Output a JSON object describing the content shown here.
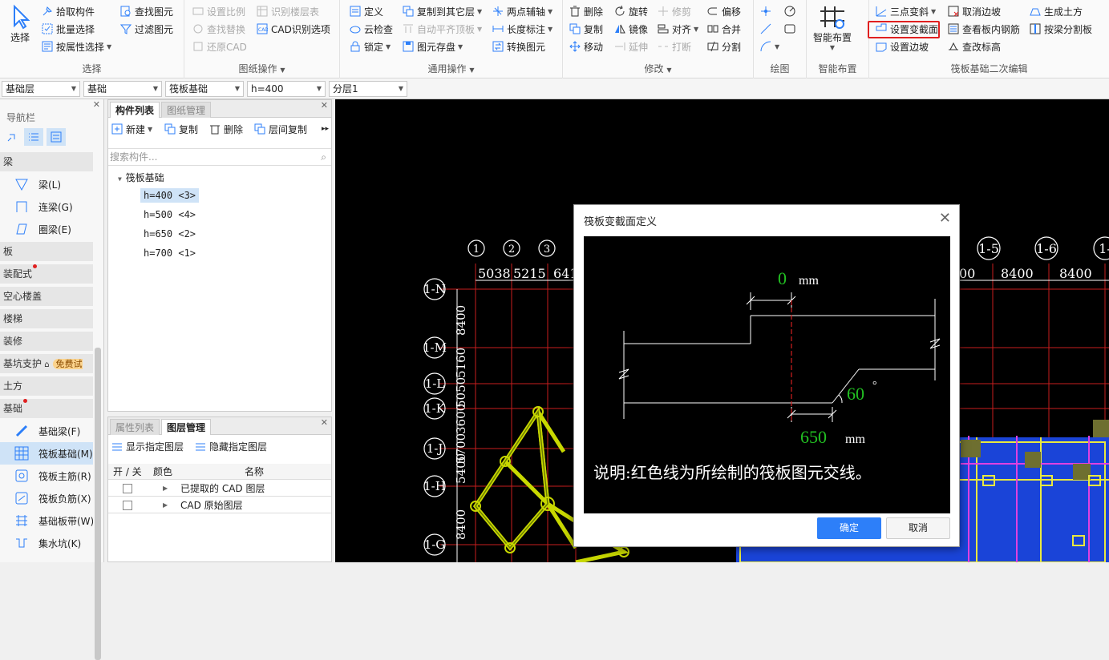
{
  "ribbon": {
    "select": {
      "big": "选择",
      "items": [
        "拾取构件",
        "批量选择",
        "按属性选择"
      ],
      "col2": [
        "查找图元",
        "过滤图元"
      ],
      "label": "选择"
    },
    "drawing_ops": {
      "col1": [
        "设置比例",
        "查找替换",
        "还原CAD"
      ],
      "col2": [
        "识别楼层表",
        "CAD识别选项"
      ],
      "label": "图纸操作"
    },
    "general_ops": {
      "col1": [
        "定义",
        "云检查",
        "锁定"
      ],
      "col2": [
        "复制到其它层",
        "自动平齐顶板",
        "图元存盘"
      ],
      "col3": [
        "两点辅轴",
        "长度标注",
        "转换图元"
      ],
      "label": "通用操作"
    },
    "modify": {
      "col1": [
        "删除",
        "复制",
        "移动"
      ],
      "col2": [
        "旋转",
        "镜像",
        "延伸"
      ],
      "col3": [
        "修剪",
        "对齐",
        "打断"
      ],
      "col4": [
        "偏移",
        "合并",
        "分割"
      ],
      "label": "修改"
    },
    "draw": {
      "label": "绘图"
    },
    "smart": {
      "big": "智能布置",
      "label": "智能布置"
    },
    "raft": {
      "col1": [
        "三点变斜",
        "设置变截面",
        "设置边坡"
      ],
      "col2": [
        "取消边坡",
        "查看板内钢筋",
        "查改标高"
      ],
      "col3": [
        "生成土方",
        "按梁分割板"
      ],
      "label": "筏板基础二次编辑"
    }
  },
  "dropdowns": [
    "基础层",
    "基础",
    "筏板基础",
    "h=400",
    "分层1"
  ],
  "nav": {
    "title": "导航栏",
    "cats": [
      "梁",
      "板",
      "装配式",
      "空心楼盖",
      "楼梯",
      "装修",
      "基坑支护",
      "土方",
      "基础"
    ],
    "free_badge": "免费试用",
    "beam_items": [
      "梁(L)",
      "连梁(G)",
      "圈梁(E)"
    ],
    "found_items": [
      "基础梁(F)",
      "筏板基础(M)",
      "筏板主筋(R)",
      "筏板负筋(X)",
      "基础板带(W)",
      "集水坑(K)"
    ]
  },
  "comp": {
    "tabs": [
      "构件列表",
      "图纸管理"
    ],
    "toolbar": [
      "新建",
      "复制",
      "删除",
      "层间复制"
    ],
    "search_placeholder": "搜索构件...",
    "tree_root": "筏板基础",
    "tree_items": [
      "h=400 <3>",
      "h=500 <4>",
      "h=650 <2>",
      "h=700 <1>"
    ]
  },
  "attr": {
    "tabs": [
      "属性列表",
      "图层管理"
    ],
    "toolbar": [
      "显示指定图层",
      "隐藏指定图层"
    ],
    "headers": [
      "开 / 关",
      "颜色",
      "名称"
    ],
    "rows": [
      "已提取的 CAD 图层",
      "CAD 原始图层"
    ]
  },
  "canvas": {
    "axis_top": [
      "1",
      "2",
      "3",
      "1-5",
      "1-6",
      "1-"
    ],
    "dims_top": [
      "5038",
      "5215",
      "641",
      "00",
      "8400",
      "8400"
    ],
    "axis_left": [
      "1-N",
      "1-M",
      "1-L",
      "1-K",
      "1-J",
      "1-H",
      "1-G"
    ],
    "dims_left": [
      "8400",
      "5160",
      "5050",
      "3600",
      "5700",
      "5400",
      "8400"
    ]
  },
  "dialog": {
    "title": "筏板变截面定义",
    "value_top": "0",
    "unit_top": "mm",
    "angle": "60",
    "deg": "°",
    "value_bottom": "650",
    "unit_bottom": "mm",
    "note": "说明:红色线为所绘制的筏板图元交线。",
    "ok": "确定",
    "cancel": "取消"
  }
}
